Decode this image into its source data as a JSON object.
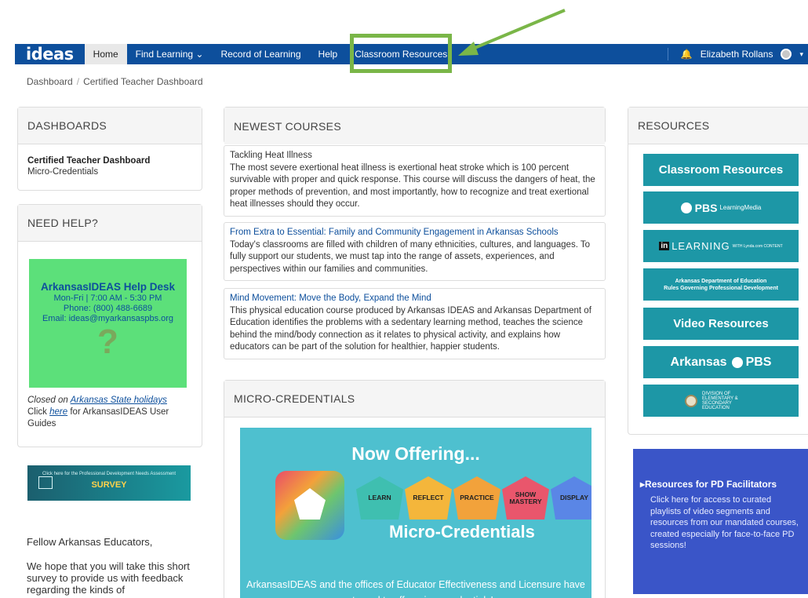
{
  "nav": {
    "logo": "ideas",
    "items": [
      "Home",
      "Find Learning",
      "Record of Learning",
      "Help",
      "Classroom Resources"
    ],
    "find_learning_caret": "⌄",
    "user": "Elizabeth Rollans",
    "user_caret": "▾"
  },
  "breadcrumb": {
    "part1": "Dashboard",
    "part2": "Certified Teacher Dashboard"
  },
  "dashboards": {
    "title": "DASHBOARDS",
    "item1": "Certified Teacher Dashboard",
    "item2": "Micro-Credentials"
  },
  "help": {
    "title": "NEED HELP?",
    "desk_title": "ArkansasIDEAS Help Desk",
    "hours": "Mon-Fri | 7:00 AM - 5:30 PM",
    "phone": "Phone: (800) 488-6689",
    "email": "Email: ideas@myarkansaspbs.org",
    "question_mark": "?",
    "closed_prefix": "Closed on ",
    "closed_link": "Arkansas State holidays",
    "click": "Click ",
    "here": "here",
    "guides": " for ArkansasIDEAS User Guides"
  },
  "survey": {
    "small": "Click here for the Professional Development Needs Assessment",
    "big": "SURVEY"
  },
  "fellow": "Fellow Arkansas Educators,",
  "hope": "We hope that you will take this short survey to provide us with feedback regarding the kinds of",
  "newest": {
    "title": "NEWEST COURSES",
    "courses": [
      {
        "title": "Tackling Heat Illness",
        "desc": "The most severe exertional heat illness is exertional heat stroke which is 100 percent survivable with proper and quick response. This course will discuss the dangers of heat, the proper methods of prevention, and most importantly, how to recognize and treat exertional heat illnesses should they occur."
      },
      {
        "title": "From Extra to Essential: Family and Community Engagement in Arkansas Schools",
        "desc": "Today's classrooms are filled with children of many ethnicities, cultures, and languages. To fully support our students, we must tap into the range of assets, experiences, and perspectives within our families and communities."
      },
      {
        "title": "Mind Movement: Move the Body, Expand the Mind",
        "desc": "This physical education course produced by Arkansas IDEAS and Arkansas Department of Education identifies the problems with a sedentary learning method, teaches the science behind the mind/body connection as it relates to physical activity, and explains how educators can be part of the solution for healthier, happier students."
      }
    ]
  },
  "micro": {
    "title": "MICRO-CREDENTIALS",
    "now": "Now Offering...",
    "steps": [
      "LEARN",
      "REFLECT",
      "PRACTICE",
      "SHOW MASTERY",
      "DISPLAY"
    ],
    "step_colors": [
      "#3fbfb0",
      "#f4b63b",
      "#f2a23b",
      "#e9566c",
      "#5a86e6"
    ],
    "word": "Micro-Credentials",
    "desc": "ArkansasIDEAS and the offices of Educator Effectiveness and Licensure have partnered to offer micro-credentials!"
  },
  "resources": {
    "title": "RESOURCES",
    "r1": "Classroom Resources",
    "r2": "PBS",
    "r2sub": "LearningMedia",
    "r3": "LEARNING",
    "r3sub": "WITH Lynda.com CONTENT",
    "r4a": "Arkansas Department of Education",
    "r4b": "Rules Governing Professional Development",
    "r5": "Video Resources",
    "r6": "Arkansas",
    "r6b": "PBS",
    "r7": "DIVISION OF ELEMENTARY & SECONDARY EDUCATION"
  },
  "pd": {
    "title": "▸Resources for PD Facilitators",
    "body": "Click here for access to curated playlists of video segments and resources from our mandated courses, created especially for face-to-face PD sessions!"
  }
}
